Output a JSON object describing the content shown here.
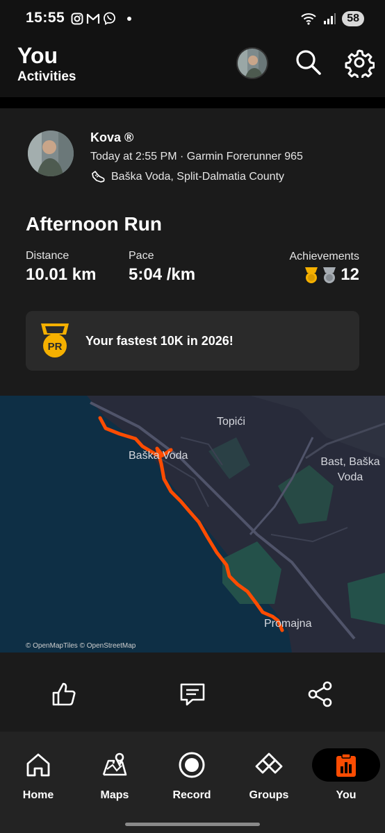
{
  "status_bar": {
    "time": "15:55",
    "battery": "58"
  },
  "header": {
    "title": "You",
    "subtitle": "Activities"
  },
  "activity": {
    "athlete_name": "Kova ®",
    "meta": "Today at 2:55 PM · Garmin Forerunner 965",
    "location": "Baška Voda, Split-Dalmatia County",
    "title": "Afternoon Run",
    "stats": {
      "distance_label": "Distance",
      "distance_value": "10.01 km",
      "pace_label": "Pace",
      "pace_value": "5:04 /km",
      "achievements_label": "Achievements",
      "achievements_count": "12"
    },
    "pr_banner": {
      "medal_text": "PR",
      "text": "Your fastest 10K in 2026!"
    }
  },
  "map": {
    "labels": {
      "topici": "Topići",
      "baska_voda": "Baška Voda",
      "bast_line1": "Bast, Baška",
      "bast_line2": "Voda",
      "promajna": "Promajna"
    },
    "attribution": "© OpenMapTiles © OpenStreetMap"
  },
  "bottom_nav": {
    "items": [
      {
        "label": "Home"
      },
      {
        "label": "Maps"
      },
      {
        "label": "Record"
      },
      {
        "label": "Groups"
      },
      {
        "label": "You"
      }
    ],
    "active": "You"
  },
  "colors": {
    "accent": "#fc4c02",
    "gold": "#f5b000",
    "background": "#121212",
    "card": "#1b1b1b"
  },
  "icons": [
    "instagram-icon",
    "gmail-icon",
    "viber-icon",
    "wifi-icon",
    "signal-icon",
    "search-icon",
    "gear-icon",
    "shoe-icon",
    "gold-medal-icon",
    "silver-medal-icon",
    "pr-medal-icon",
    "thumbs-up-icon",
    "comment-icon",
    "share-icon",
    "home-icon",
    "maps-icon",
    "record-icon",
    "groups-icon",
    "you-icon"
  ]
}
